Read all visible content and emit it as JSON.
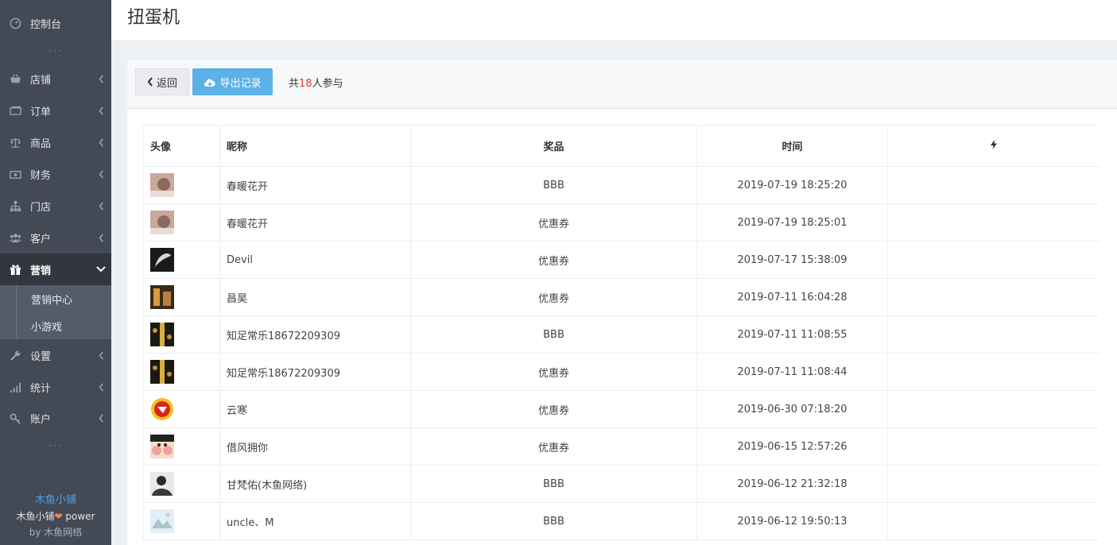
{
  "app": {
    "page_title": "扭蛋机"
  },
  "sidebar": {
    "top_item": {
      "label": "控制台",
      "icon": "dashboard-icon"
    },
    "items": [
      {
        "label": "店铺",
        "icon": "shop-icon",
        "expanded": false
      },
      {
        "label": "订单",
        "icon": "order-icon",
        "expanded": false
      },
      {
        "label": "商品",
        "icon": "scale-icon",
        "expanded": false
      },
      {
        "label": "财务",
        "icon": "money-icon",
        "expanded": false
      },
      {
        "label": "门店",
        "icon": "sitemap-icon",
        "expanded": false
      },
      {
        "label": "客户",
        "icon": "users-icon",
        "expanded": false
      },
      {
        "label": "营销",
        "icon": "gift-icon",
        "expanded": true
      },
      {
        "label": "设置",
        "icon": "wrench-icon",
        "expanded": false
      },
      {
        "label": "统计",
        "icon": "signal-icon",
        "expanded": false
      },
      {
        "label": "账户",
        "icon": "key-icon",
        "expanded": false
      }
    ],
    "submenu": [
      {
        "label": "营销中心"
      },
      {
        "label": "小游戏"
      }
    ],
    "dots": "···",
    "footer": {
      "brand": "木鱼小铺",
      "power_prefix": "木鱼小铺",
      "power_suffix": " power",
      "by_prefix": "by ",
      "by_name": "木鱼网络"
    }
  },
  "toolbar": {
    "back_label": "返回",
    "export_label": "导出记录",
    "participants_prefix": "共",
    "participants_count": "18",
    "participants_suffix": "人参与"
  },
  "table": {
    "headers": {
      "avatar": "头像",
      "nickname": "昵称",
      "prize": "奖品",
      "time": "时间",
      "action_icon": "bolt-icon"
    },
    "rows": [
      {
        "avatar": "photo-avatar",
        "nickname": "春暖花开",
        "prize": "BBB",
        "time": "2019-07-19 18:25:20"
      },
      {
        "avatar": "photo-avatar",
        "nickname": "春暖花开",
        "prize": "优惠券",
        "time": "2019-07-19 18:25:01"
      },
      {
        "avatar": "photo-avatar",
        "nickname": "Devil",
        "prize": "优惠券",
        "time": "2019-07-17 15:38:09"
      },
      {
        "avatar": "photo-avatar",
        "nickname": "昌昊",
        "prize": "优惠券",
        "time": "2019-07-11 16:04:28"
      },
      {
        "avatar": "photo-avatar",
        "nickname": "知足常乐18672209309",
        "prize": "BBB",
        "time": "2019-07-11 11:08:55"
      },
      {
        "avatar": "photo-avatar",
        "nickname": "知足常乐18672209309",
        "prize": "优惠券",
        "time": "2019-07-11 11:08:44"
      },
      {
        "avatar": "badge-avatar",
        "nickname": "云寒",
        "prize": "优惠券",
        "time": "2019-06-30 07:18:20"
      },
      {
        "avatar": "cartoon-avatar",
        "nickname": "借风拥你",
        "prize": "优惠券",
        "time": "2019-06-15 12:57:26"
      },
      {
        "avatar": "photo-avatar",
        "nickname": "甘梵佑(木鱼网络)",
        "prize": "BBB",
        "time": "2019-06-12 21:32:18"
      },
      {
        "avatar": "placeholder-avatar",
        "nickname": "uncle、M",
        "prize": "BBB",
        "time": "2019-06-12 19:50:13"
      }
    ]
  },
  "colors": {
    "sidebar_bg": "#434a56",
    "sidebar_active": "#31363f",
    "primary_button": "#5bb1e8",
    "count_red": "#e4393c",
    "brand_blue": "#4a9fe8"
  }
}
